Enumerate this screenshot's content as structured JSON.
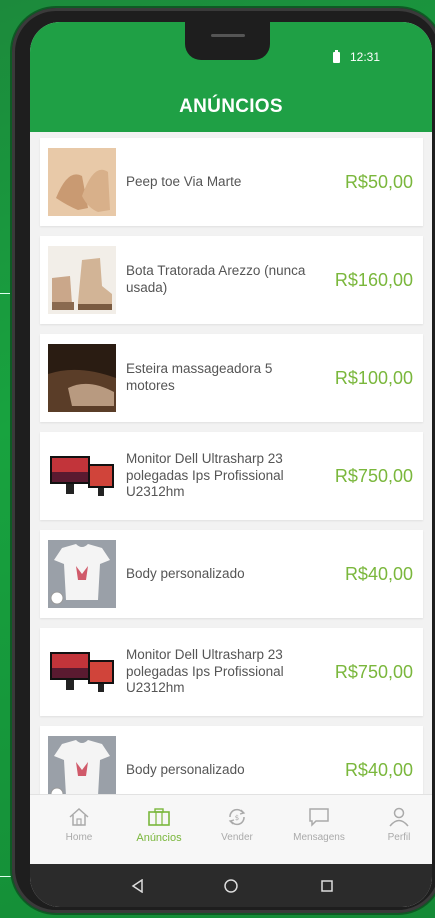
{
  "status_bar": {
    "time": "12:31"
  },
  "header": {
    "title": "ANÚNCIOS"
  },
  "listings": [
    {
      "title": "Peep toe Via Marte",
      "price": "R$50,00",
      "thumb": "shoe-icon"
    },
    {
      "title": "Bota Tratorada Arezzo (nunca usada)",
      "price": "R$160,00",
      "thumb": "boot-icon"
    },
    {
      "title": "Esteira massageadora 5 motores",
      "price": "R$100,00",
      "thumb": "massager-icon"
    },
    {
      "title": "Monitor Dell Ultrasharp 23 polegadas Ips Profissional U2312hm",
      "price": "R$750,00",
      "thumb": "monitor-icon"
    },
    {
      "title": "Body personalizado",
      "price": "R$40,00",
      "thumb": "baby-body-icon"
    },
    {
      "title": "Monitor Dell Ultrasharp 23 polegadas Ips Profissional U2312hm",
      "price": "R$750,00",
      "thumb": "monitor-icon"
    },
    {
      "title": "Body personalizado",
      "price": "R$40,00",
      "thumb": "baby-body-icon"
    }
  ],
  "bottom_nav": [
    {
      "label": "Home",
      "icon": "home-icon",
      "active": false
    },
    {
      "label": "Anúncios",
      "icon": "briefcase-icon",
      "active": true
    },
    {
      "label": "Vender",
      "icon": "sell-icon",
      "active": false
    },
    {
      "label": "Mensagens",
      "icon": "chat-icon",
      "active": false
    },
    {
      "label": "Perfil",
      "icon": "user-icon",
      "active": false
    }
  ],
  "colors": {
    "brand_green": "#1fa045",
    "price_green": "#7ab73c"
  }
}
